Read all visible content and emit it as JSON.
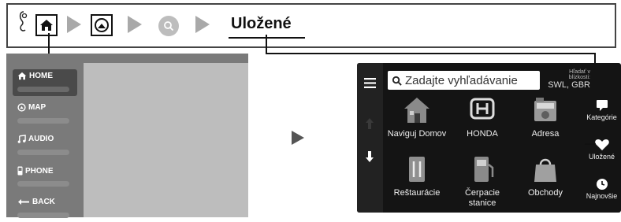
{
  "breadcrumb": {
    "icons": [
      "voice-icon",
      "home-icon",
      "navigation-icon",
      "search-icon"
    ],
    "current": "Uložené"
  },
  "menu": {
    "items": [
      {
        "label": "HOME",
        "icon": "home-icon",
        "active": true
      },
      {
        "label": "MAP",
        "icon": "map-icon",
        "active": false
      },
      {
        "label": "AUDIO",
        "icon": "music-note-icon",
        "active": false
      },
      {
        "label": "PHONE",
        "icon": "phone-icon",
        "active": false
      },
      {
        "label": "BACK",
        "icon": "back-icon",
        "active": false
      }
    ]
  },
  "nav": {
    "search_placeholder": "Zadajte vyhľadávanie",
    "nearby_label": "Hľadať v blízkosti:",
    "nearby_value": "SWL, GBR",
    "tiles": [
      {
        "label": "Naviguj Domov",
        "icon": "house-icon"
      },
      {
        "label": "HONDA",
        "icon": "honda-logo-icon"
      },
      {
        "label": "Adresa",
        "icon": "address-book-icon"
      },
      {
        "label": "Reštaurácie",
        "icon": "restaurant-icon"
      },
      {
        "label": "Čerpacie stanice",
        "icon": "fuel-pump-icon"
      },
      {
        "label": "Obchody",
        "icon": "shopping-bag-icon"
      }
    ],
    "right": [
      {
        "label": "Kategórie",
        "icon": "category-icon"
      },
      {
        "label": "Uložené",
        "icon": "heart-icon"
      },
      {
        "label": "Najnovšie",
        "icon": "clock-icon"
      }
    ]
  },
  "colors": {
    "accent": "#1a1a1a",
    "panel": "#7a7a7a",
    "screen_bg": "#141414"
  }
}
